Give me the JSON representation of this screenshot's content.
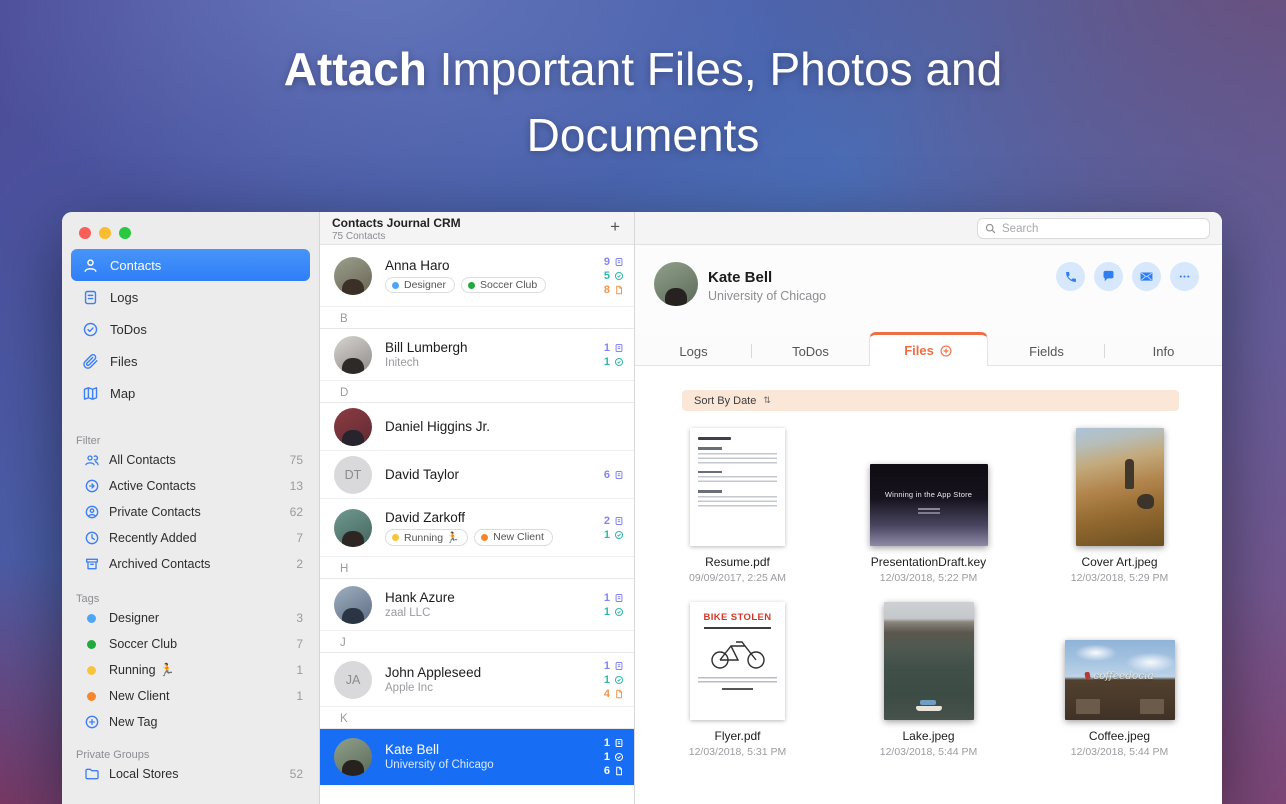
{
  "colors": {
    "accent_blue": "#2e7ef0",
    "sidebar_selected_blue": "#3d8bf8",
    "selected_row_blue": "#176ef4",
    "files_tab_orange": "#ee6f44",
    "sort_bar_bg": "#fbe7d8",
    "log_count": "#8287f0",
    "todo_count": "#2fb8a8",
    "file_count": "#f0964f",
    "tag_designer": "#4da6f5",
    "tag_soccer_club": "#1faa3c",
    "tag_running": "#f7c53d",
    "tag_new_client": "#f5862c",
    "traffic_red": "#f85f57",
    "traffic_yellow": "#fcbc2f",
    "traffic_green": "#28c840"
  },
  "headline": {
    "bold": "Attach",
    "rest": " Important Files, Photos and",
    "line2": "Documents"
  },
  "sidebar": {
    "nav": [
      {
        "label": "Contacts"
      },
      {
        "label": "Logs"
      },
      {
        "label": "ToDos"
      },
      {
        "label": "Files"
      },
      {
        "label": "Map"
      }
    ],
    "filter_label": "Filter",
    "filters": [
      {
        "label": "All Contacts",
        "count": "75"
      },
      {
        "label": "Active Contacts",
        "count": "13"
      },
      {
        "label": "Private Contacts",
        "count": "62"
      },
      {
        "label": "Recently Added",
        "count": "7"
      },
      {
        "label": "Archived Contacts",
        "count": "2"
      }
    ],
    "tags_label": "Tags",
    "tags": [
      {
        "label": "Designer",
        "count": "3"
      },
      {
        "label": "Soccer Club",
        "count": "7"
      },
      {
        "label": "Running 🏃",
        "count": "1"
      },
      {
        "label": "New Client",
        "count": "1"
      }
    ],
    "new_tag_label": "New Tag",
    "groups_label": "Private Groups",
    "groups": [
      {
        "label": "Local Stores",
        "count": "52"
      }
    ]
  },
  "list": {
    "title": "Contacts Journal CRM",
    "subtitle": "75 Contacts",
    "add_button": "+",
    "sections": {
      "b": "B",
      "d": "D",
      "h": "H",
      "j": "J",
      "k": "K"
    },
    "anna": {
      "name": "Anna Haro",
      "tag1": "Designer",
      "tag2": "Soccer Club",
      "logs": "9",
      "todos": "5",
      "files": "8"
    },
    "bill": {
      "name": "Bill Lumbergh",
      "company": "Initech",
      "logs": "1",
      "todos": "1"
    },
    "daniel": {
      "name": "Daniel Higgins Jr."
    },
    "david_taylor": {
      "name": "David Taylor",
      "initials": "DT",
      "logs": "6"
    },
    "david_zarkoff": {
      "name": "David Zarkoff",
      "tag1": "Running 🏃",
      "tag2": "New Client",
      "logs": "2",
      "todos": "1"
    },
    "hank": {
      "name": "Hank Azure",
      "company": "zaal LLC",
      "logs": "1",
      "todos": "1"
    },
    "john": {
      "name": "John Appleseed",
      "company": "Apple Inc",
      "initials": "JA",
      "logs": "1",
      "todos": "1",
      "files": "4"
    },
    "kate": {
      "name": "Kate Bell",
      "company": "University of Chicago",
      "logs": "1",
      "todos": "1",
      "files": "6"
    }
  },
  "detail": {
    "search_placeholder": "Search",
    "contact": {
      "name": "Kate Bell",
      "org": "University of Chicago"
    },
    "tabs": {
      "logs": "Logs",
      "todos": "ToDos",
      "files": "Files",
      "fields": "Fields",
      "info": "Info"
    },
    "sort_label": "Sort By Date",
    "sort_glyph": "⇅",
    "files": [
      {
        "name": "Resume.pdf",
        "date": "09/09/2017, 2:25 AM"
      },
      {
        "name": "PresentationDraft.key",
        "date": "12/03/2018, 5:22 PM",
        "slide_title": "Winning in the App Store"
      },
      {
        "name": "Cover Art.jpeg",
        "date": "12/03/2018, 5:29 PM"
      },
      {
        "name": "Flyer.pdf",
        "date": "12/03/2018, 5:31 PM",
        "flyer_title": "BIKE STOLEN"
      },
      {
        "name": "Lake.jpeg",
        "date": "12/03/2018, 5:44 PM"
      },
      {
        "name": "Coffee.jpeg",
        "date": "12/03/2018, 5:44 PM",
        "sign_text": "coffeedocia"
      }
    ]
  }
}
